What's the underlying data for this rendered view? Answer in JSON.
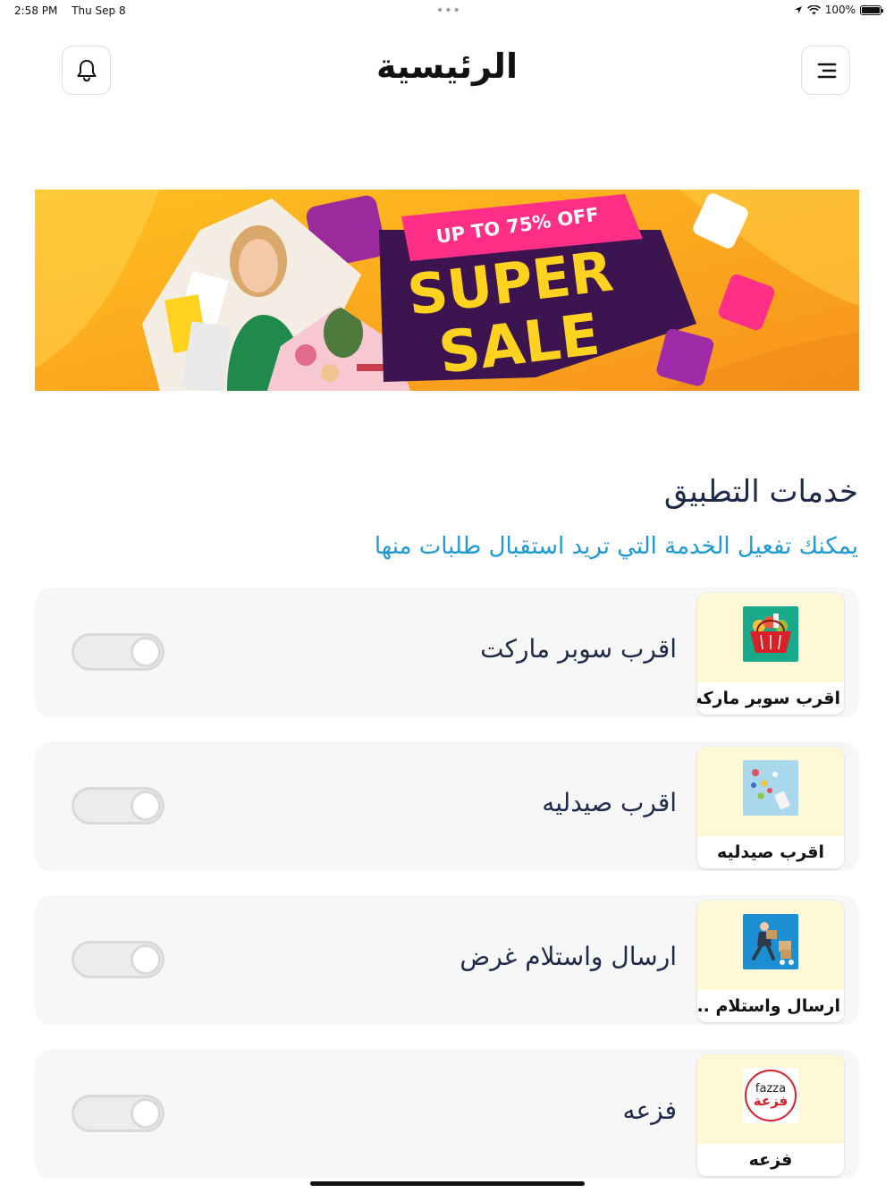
{
  "status_bar": {
    "time": "2:58 PM",
    "date": "Thu Sep 8",
    "battery": "100%"
  },
  "header": {
    "title": "الرئيسية"
  },
  "banner": {
    "top_text": "UP TO 75% OFF",
    "line1": "SUPER",
    "line2": "SALE"
  },
  "section": {
    "title": "خدمات التطبيق",
    "subtitle": "يمكنك تفعيل الخدمة التي تريد استقبال طلبات منها"
  },
  "services": [
    {
      "thumb_label": "اقرب سوبر ماركت",
      "name": "اقرب سوبر ماركت",
      "enabled": false
    },
    {
      "thumb_label": "اقرب صيدليه",
      "name": "اقرب صيدليه",
      "enabled": false
    },
    {
      "thumb_label": "ارسال واستلام ...",
      "name": "ارسال واستلام غرض",
      "enabled": false
    },
    {
      "thumb_label": "فزعه",
      "name": "فزعه",
      "enabled": false,
      "logo_latin": "fazza",
      "logo_arabic": "فزعة"
    }
  ],
  "colors": {
    "accent_blue": "#1d9ad6",
    "title_navy": "#1e2a4a",
    "card_bg": "#f7f7f7",
    "thumb_bg": "#fff8d6",
    "banner_orange": "#f9a31a",
    "banner_purple": "#4a1a5e",
    "banner_yellow": "#ffd21f"
  }
}
